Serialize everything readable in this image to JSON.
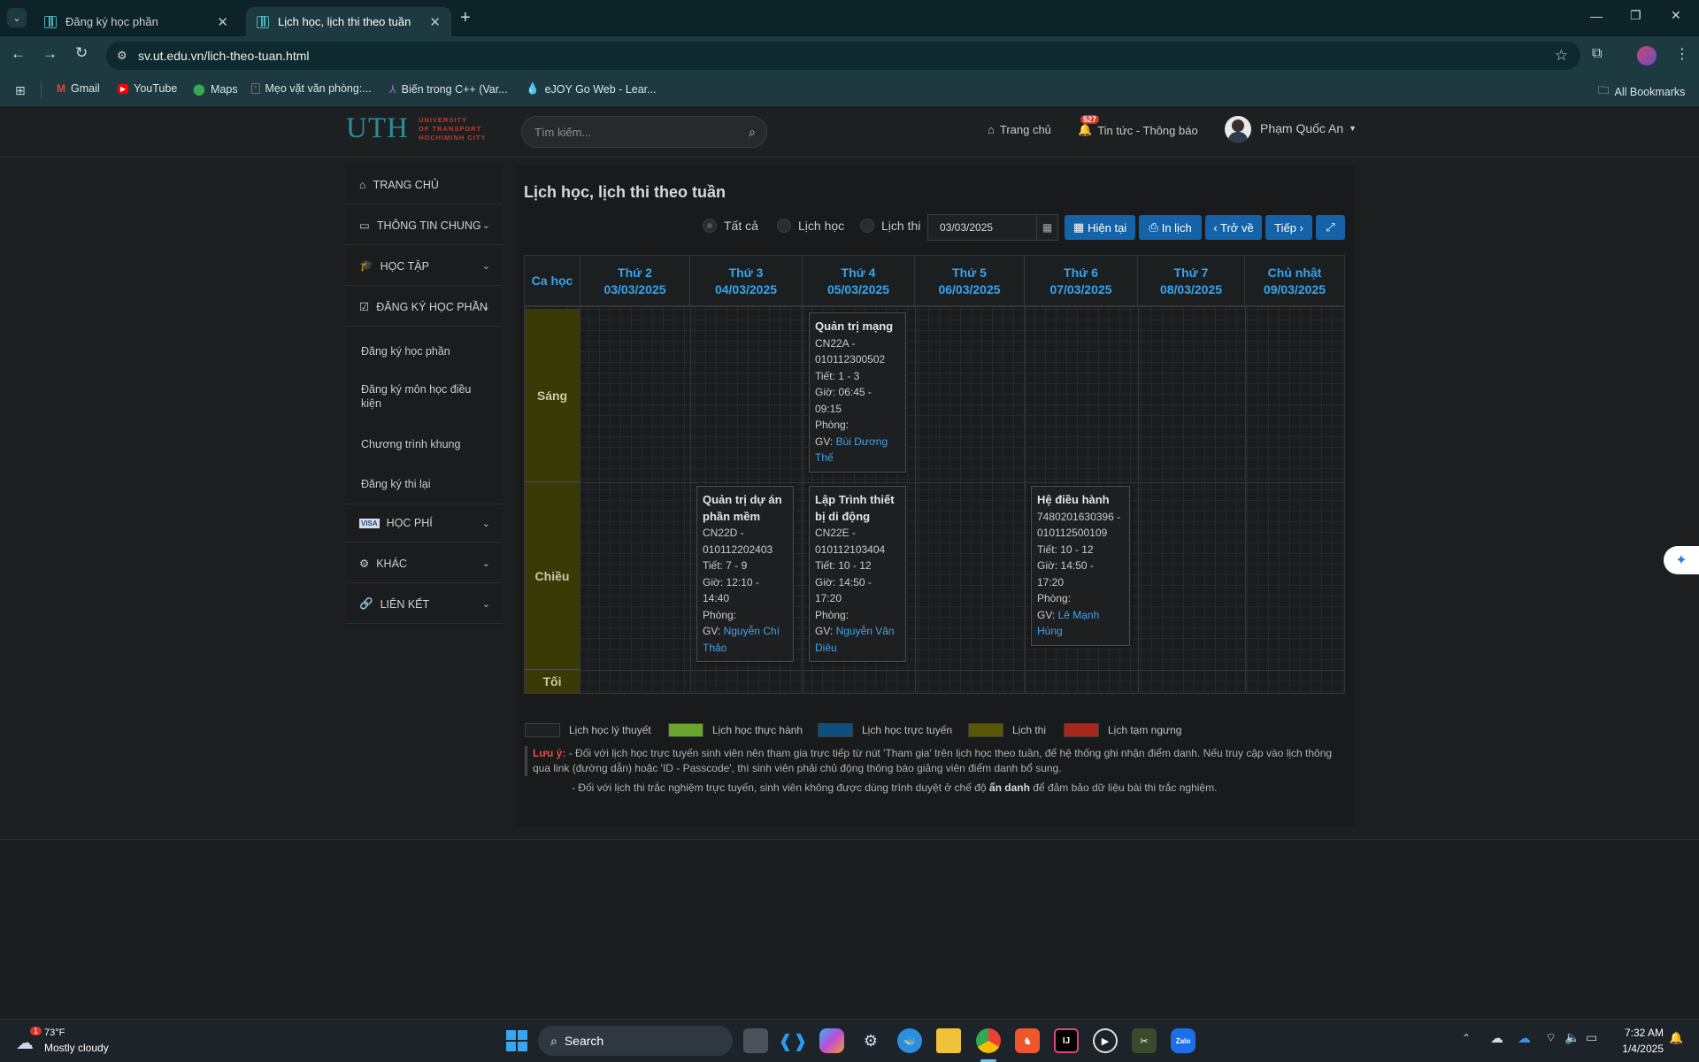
{
  "browser": {
    "tabs": [
      {
        "title": "Đăng ký học phần"
      },
      {
        "title": "Lịch học, lịch thi theo tuần"
      }
    ],
    "url": "sv.ut.edu.vn/lich-theo-tuan.html",
    "bookmarks": [
      {
        "label": "Gmail"
      },
      {
        "label": "YouTube"
      },
      {
        "label": "Maps"
      },
      {
        "label": "Mẹo vặt văn phòng:..."
      },
      {
        "label": "Biến trong C++ (Var..."
      },
      {
        "label": "eJOY Go Web - Lear..."
      }
    ],
    "all_bookmarks": "All Bookmarks"
  },
  "header": {
    "logo_text": "UTH",
    "logo_sub": [
      "UNIVERSITY",
      "OF TRANSPORT",
      "HOCHIMINH CITY"
    ],
    "search_placeholder": "Tìm kiếm...",
    "home": "Trang chủ",
    "news_badge": "527",
    "news": "Tin tức - Thông báo",
    "user": "Phạm Quốc An"
  },
  "sidebar": {
    "items": [
      {
        "label": "TRANG CHỦ"
      },
      {
        "label": "THÔNG TIN CHUNG"
      },
      {
        "label": "HỌC TẬP"
      },
      {
        "label": "ĐĂNG KÝ HỌC PHẦN"
      },
      {
        "label": "HỌC PHÍ"
      },
      {
        "label": "KHÁC"
      },
      {
        "label": "LIÊN KẾT"
      }
    ],
    "sub_items": [
      {
        "label": "Đăng ký học phần"
      },
      {
        "label": "Đăng ký môn học điều kiện"
      },
      {
        "label": "Chương trình khung"
      },
      {
        "label": "Đăng ký thi lại"
      }
    ]
  },
  "main": {
    "title": "Lịch học, lịch thi theo tuần",
    "filters": [
      "Tất cả",
      "Lịch học",
      "Lịch thi"
    ],
    "date": "03/03/2025",
    "buttons": {
      "current": "Hiện tại",
      "print": "In lịch",
      "back": "‹ Trở về",
      "next": "Tiếp ›"
    },
    "shift_header": "Ca học",
    "days": [
      {
        "name": "Thứ 2",
        "date": "03/03/2025"
      },
      {
        "name": "Thứ 3",
        "date": "04/03/2025"
      },
      {
        "name": "Thứ 4",
        "date": "05/03/2025"
      },
      {
        "name": "Thứ 5",
        "date": "06/03/2025"
      },
      {
        "name": "Thứ 6",
        "date": "07/03/2025"
      },
      {
        "name": "Thứ 7",
        "date": "08/03/2025"
      },
      {
        "name": "Chủ nhật",
        "date": "09/03/2025"
      }
    ],
    "shifts": [
      "Sáng",
      "Chiều",
      "Tối"
    ],
    "classes": [
      {
        "name": "Quản trị mạng",
        "code1": "CN22A -",
        "code2": "010112300502",
        "tiet": "Tiết: 1 - 3",
        "gio1": "Giờ: 06:45 -",
        "gio2": "09:15",
        "phong": "Phòng:",
        "gv_label": "GV: ",
        "gv": "Bùi Dương",
        "gv2": "Thế"
      },
      {
        "name": "Quản trị dự án phần mềm",
        "code1": "CN22D -",
        "code2": "010112202403",
        "tiet": "Tiết: 7 - 9",
        "gio1": "Giờ: 12:10 -",
        "gio2": "14:40",
        "phong": "Phòng:",
        "gv_label": "GV: ",
        "gv": "Nguyễn Chí",
        "gv2": "Thảo"
      },
      {
        "name": "Lập Trình thiết bị di động",
        "code1": "CN22E -",
        "code2": "010112103404",
        "tiet": "Tiết: 10 - 12",
        "gio1": "Giờ: 14:50 -",
        "gio2": "17:20",
        "phong": "Phòng:",
        "gv_label": "GV: ",
        "gv": "Nguyễn Văn",
        "gv2": "Diêu"
      },
      {
        "name": "Hệ điều hành",
        "code1": "7480201630396 -",
        "code2": "010112500109",
        "tiet": "Tiết: 10 - 12",
        "gio1": "Giờ: 14:50 -",
        "gio2": "17:20",
        "phong": "Phòng:",
        "gv_label": "GV: ",
        "gv": "Lê Mạnh",
        "gv2": "Hùng"
      }
    ],
    "legend": [
      {
        "label": "Lịch học lý thuyết",
        "color": "#1e2122"
      },
      {
        "label": "Lịch học thực hành",
        "color": "#6aa52e"
      },
      {
        "label": "Lịch học trực tuyến",
        "color": "#0f4f7e"
      },
      {
        "label": "Lịch thi",
        "color": "#5a5808"
      },
      {
        "label": "Lịch tạm ngưng",
        "color": "#a8261c"
      }
    ],
    "note_label": "Lưu ý:",
    "note1": "- Đối với lịch học trực tuyến sinh viên nên tham gia trực tiếp từ nút 'Tham gia' trên lịch học theo tuần, để hệ thống ghi nhận điểm danh. Nếu truy cập vào lịch thông qua link (đường dẫn) hoặc 'ID - Passcode', thì sinh viên phải chủ động thông báo giảng viên điểm danh bổ sung.",
    "note2_a": "- Đối với lịch thi trắc nghiệm trực tuyến, sinh viên không được dùng trình duyệt ở chế độ ",
    "note2_b": "ẩn danh",
    "note2_c": " để đảm bảo dữ liệu bài thi trắc nghiệm."
  },
  "taskbar": {
    "weather_temp": "73°F",
    "weather_desc": "Mostly cloudy",
    "weather_badge": "1",
    "search": "Search",
    "time": "7:32 AM",
    "date": "1/4/2025"
  }
}
